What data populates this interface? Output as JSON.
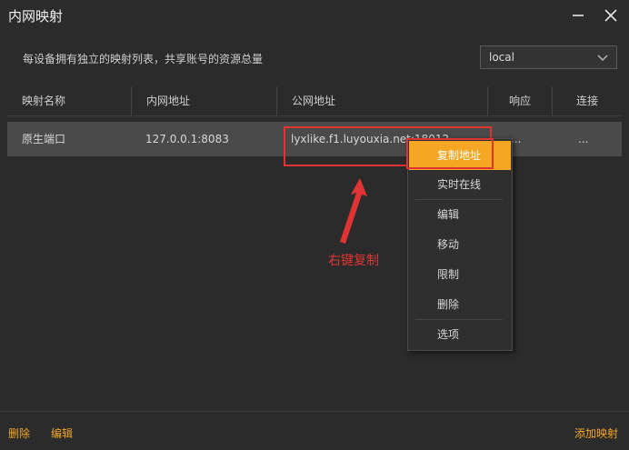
{
  "window": {
    "title": "内网映射"
  },
  "description": "每设备拥有独立的映射列表，共享账号的资源总量",
  "device_select": {
    "value": "local"
  },
  "table": {
    "headers": [
      "映射名称",
      "内网地址",
      "公网地址",
      "响应",
      "连接"
    ],
    "rows": [
      {
        "name": "原生端口",
        "local_addr": "127.0.0.1:8083",
        "public_addr": "lyxlike.f1.luyouxia.net:18012",
        "response": "...",
        "connection": "..."
      }
    ]
  },
  "context_menu": {
    "items": [
      "复制地址",
      "实时在线",
      "编辑",
      "移动",
      "限制",
      "删除",
      "选项"
    ],
    "active_index": 0
  },
  "annotation": "右键复制",
  "footer": {
    "delete": "删除",
    "edit": "编辑",
    "add": "添加映射"
  },
  "colors": {
    "accent": "#f5a623",
    "highlight": "#e03434",
    "background": "#2b2b2b",
    "selected_row": "#4a4a4a"
  },
  "icons": {
    "minimize": "minimize-icon",
    "close": "close-icon",
    "dropdown": "chevron-down-icon"
  }
}
